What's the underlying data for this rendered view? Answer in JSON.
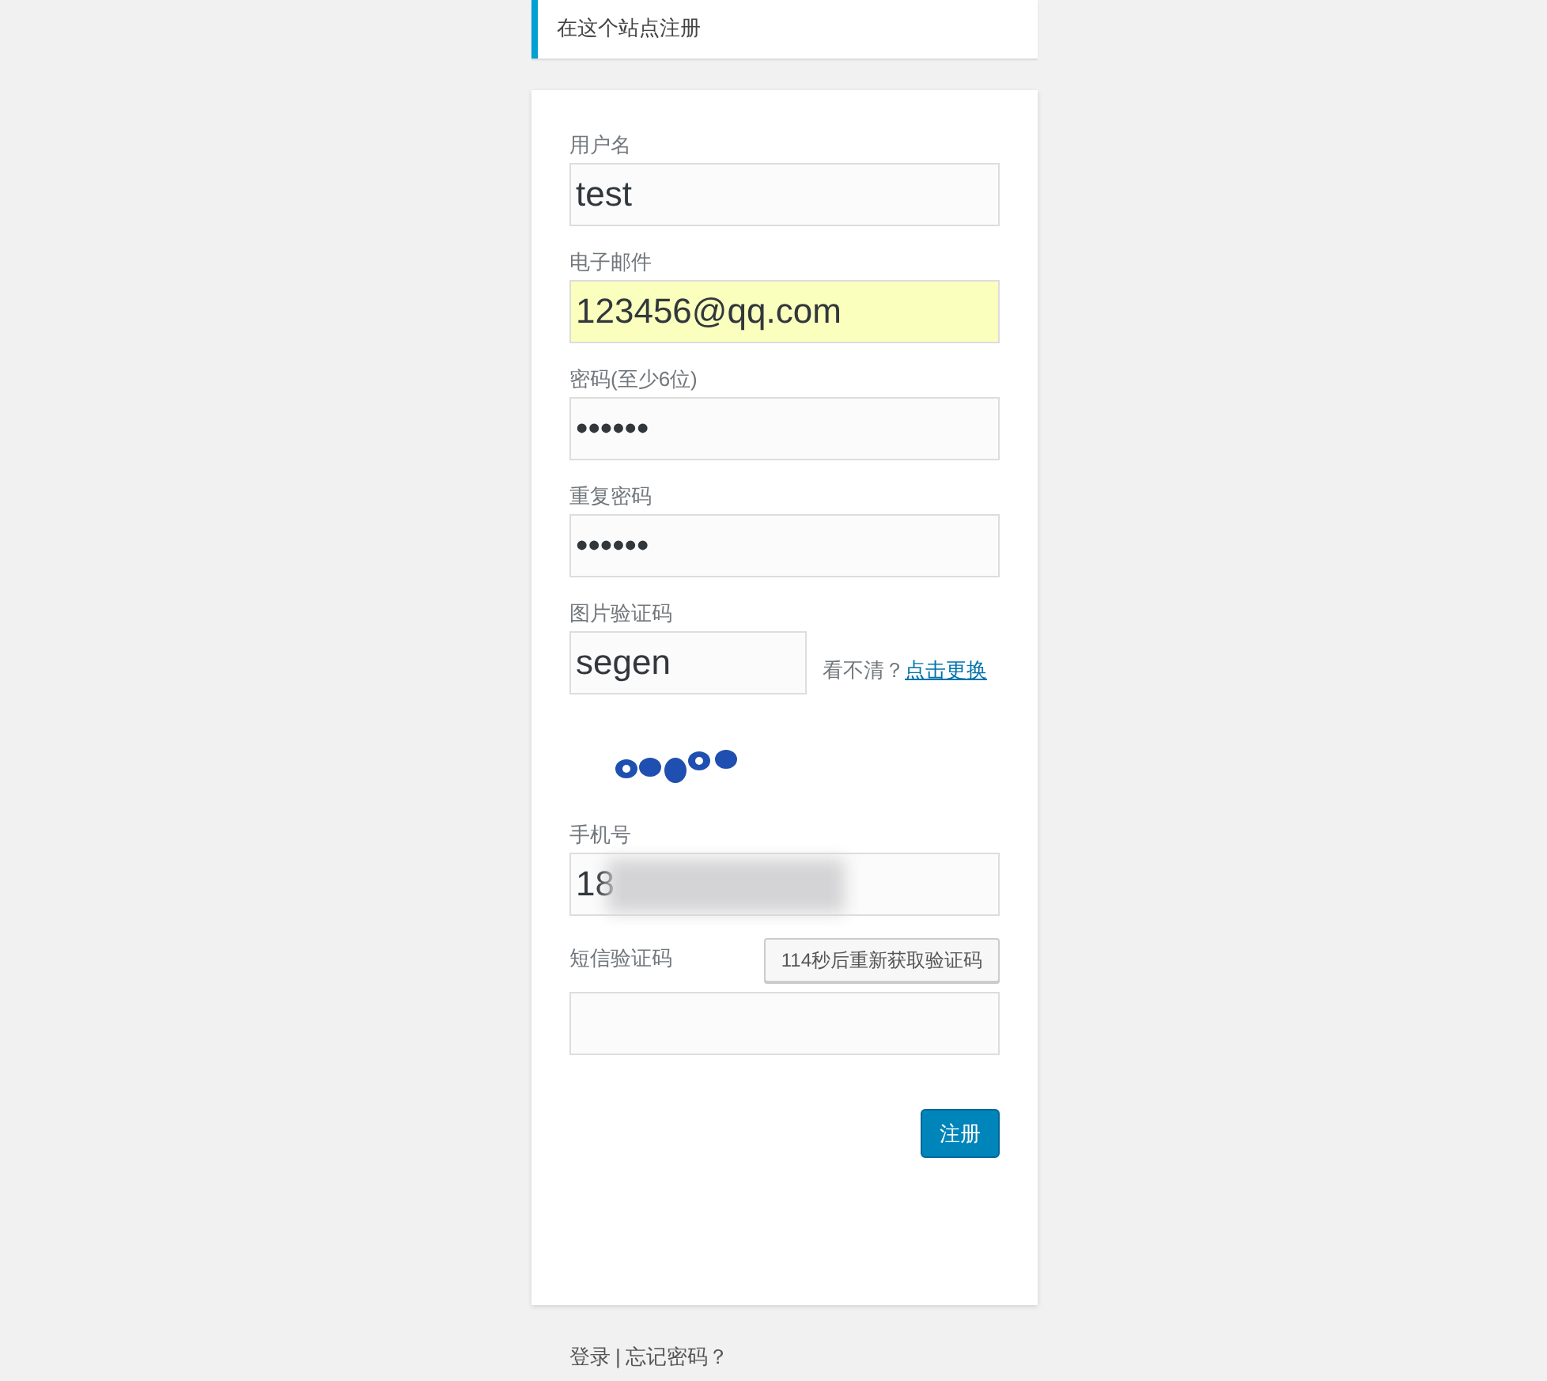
{
  "notice": "在这个站点注册",
  "fields": [
    {
      "kind": "text",
      "label": "用户名",
      "value": "test",
      "autofilled": false
    },
    {
      "kind": "text",
      "label": "电子邮件",
      "value": "123456@qq.com",
      "autofilled": true
    },
    {
      "kind": "text",
      "label": "密码(至少6位)",
      "value": "••••••",
      "autofilled": false
    },
    {
      "kind": "text",
      "label": "重复密码",
      "value": "••••••",
      "autofilled": false
    },
    {
      "kind": "captcha",
      "label": "图片验证码",
      "value": "segen",
      "hint": "看不清？",
      "link": "点击更换"
    },
    {
      "kind": "phone",
      "label": "手机号",
      "value": "18"
    },
    {
      "kind": "sms",
      "label": "短信验证码",
      "button": "114秒后重新获取验证码"
    }
  ],
  "submit": "注册",
  "footer": {
    "links": [
      "登录",
      "忘记密码？"
    ],
    "separator": "|"
  }
}
